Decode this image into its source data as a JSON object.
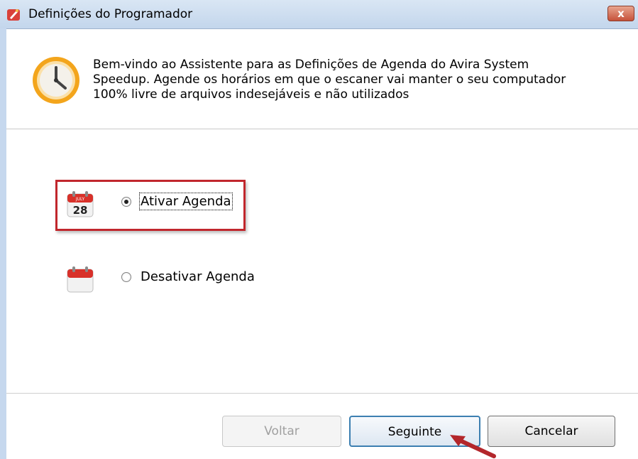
{
  "window": {
    "title": "Definições do Programador",
    "close_label": "x"
  },
  "header": {
    "welcome_lines": [
      "Bem-vindo ao Assistente para as Definições de Agenda do Avira System",
      "Speedup. Agende os horários em que o escaner vai manter o seu computador",
      "100% livre de arquivos indesejáveis e não utilizados"
    ],
    "icon": "clock-icon"
  },
  "options": {
    "enable": {
      "label": "Ativar Agenda",
      "checked": true,
      "icon": "calendar-28-icon",
      "calendar_month": "JULY",
      "calendar_day": "28"
    },
    "disable": {
      "label": "Desativar Agenda",
      "checked": false,
      "icon": "calendar-blank-icon"
    }
  },
  "buttons": {
    "back": {
      "label": "Voltar",
      "enabled": false
    },
    "next": {
      "label": "Seguinte",
      "enabled": true
    },
    "cancel": {
      "label": "Cancelar",
      "enabled": true
    }
  },
  "colors": {
    "highlight": "#c1272d",
    "accent": "#3c7fb1",
    "clock_orange": "#f0a020"
  }
}
